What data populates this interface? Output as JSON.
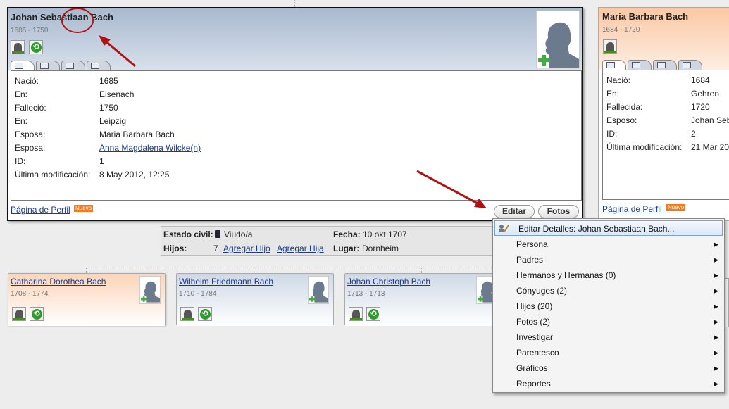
{
  "main_person": {
    "name": "Johan Sebastiaan Bach",
    "dates": "1685 - 1750",
    "details": [
      {
        "label": "Nació:",
        "value": "1685",
        "link": false
      },
      {
        "label": "En:",
        "value": "Eisenach",
        "link": false
      },
      {
        "label": "Falleció:",
        "value": "1750",
        "link": false
      },
      {
        "label": "En:",
        "value": "Leipzig",
        "link": false
      },
      {
        "label": "Esposa:",
        "value": "Maria Barbara Bach",
        "link": false
      },
      {
        "label": "Esposa:",
        "value": "Anna Magdalena Wilcke(n)",
        "link": true
      },
      {
        "label": "ID:",
        "value": "1",
        "link": false
      },
      {
        "label": "Última modificación:",
        "value": "8 May 2012, 12:25",
        "link": false
      }
    ],
    "profile_link": "Página de Perfil",
    "new_badge": "Nuevo",
    "edit_button": "Editar",
    "photos_button": "Fotos"
  },
  "spouse": {
    "name": "Maria Barbara Bach",
    "dates": "1684 - 1720",
    "details": [
      {
        "label": "Nació:",
        "value": "1684"
      },
      {
        "label": "En:",
        "value": "Gehren"
      },
      {
        "label": "Fallecida:",
        "value": "1720"
      },
      {
        "label": "Esposo:",
        "value": "Johan Seb"
      },
      {
        "label": "ID:",
        "value": "2"
      },
      {
        "label": "Última modificación:",
        "value": "21 Mar 20"
      }
    ],
    "profile_link": "Página de Perfil",
    "new_badge": "Nuevo"
  },
  "marriage": {
    "status_label": "Estado civil:",
    "status_value": "Viudo/a",
    "date_label": "Fecha:",
    "date_value": "10 okt 1707",
    "children_label": "Hijos:",
    "children_count": "7",
    "add_son": "Agregar Hijo",
    "add_daughter": "Agregar Hija",
    "place_label": "Lugar:",
    "place_value": "Dornheim"
  },
  "children": [
    {
      "name": "Catharina Dorothea Bach",
      "dates": "1708 - 1774",
      "gender": "f"
    },
    {
      "name": "Wilhelm Friedmann Bach",
      "dates": "1710 - 1784",
      "gender": "m"
    },
    {
      "name": "Johan Christoph Bach",
      "dates": "1713 - 1713",
      "gender": "m"
    }
  ],
  "context_menu": {
    "items": [
      {
        "label": "Editar Detalles: Johan Sebastiaan Bach...",
        "submenu": false,
        "highlighted": true
      },
      {
        "label": "Persona",
        "submenu": true
      },
      {
        "label": "Padres",
        "submenu": true
      },
      {
        "label": "Hermanos y Hermanas (0)",
        "submenu": true
      },
      {
        "label": "Cónyuges (2)",
        "submenu": true
      },
      {
        "label": "Hijos (20)",
        "submenu": true
      },
      {
        "label": "Fotos (2)",
        "submenu": true
      },
      {
        "label": "Investigar",
        "submenu": true
      },
      {
        "label": "Parentesco",
        "submenu": true
      },
      {
        "label": "Gráficos",
        "submenu": true
      },
      {
        "label": "Reportes",
        "submenu": true
      }
    ]
  },
  "colors": {
    "annotation": "#b01212",
    "male_header": "#a9b9cf",
    "female_header": "#fbc8a4",
    "badge": "#f57a1c"
  }
}
